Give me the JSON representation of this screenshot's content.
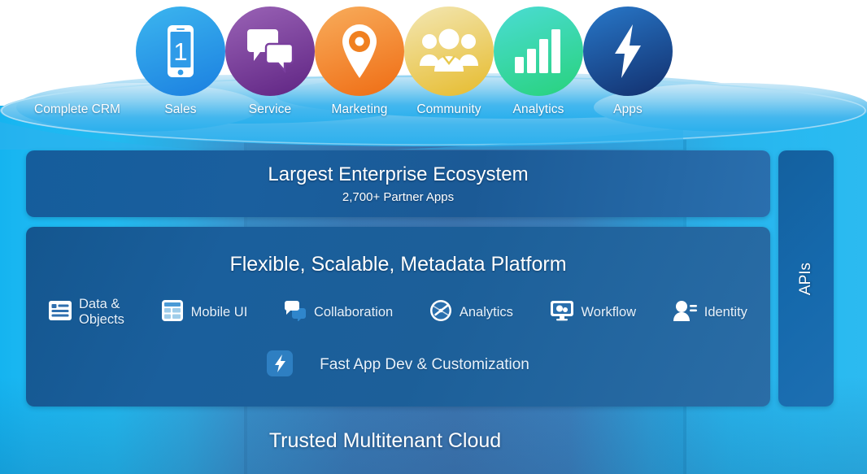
{
  "diagram": {
    "top_row": {
      "standalone_label": "Complete CRM",
      "nodes": [
        {
          "label": "Sales",
          "icon": "mobile-phone-icon",
          "color_from": "#3cb6ef",
          "color_to": "#1b7fe0"
        },
        {
          "label": "Service",
          "icon": "chat-bubbles-icon",
          "color_from": "#8f5fb0",
          "color_to": "#6a2a8c"
        },
        {
          "label": "Marketing",
          "icon": "map-pin-icon",
          "color_from": "#f5a04a",
          "color_to": "#f2711c"
        },
        {
          "label": "Community",
          "icon": "people-group-icon",
          "color_from": "#efe0a8",
          "color_to": "#e8bf33"
        },
        {
          "label": "Analytics",
          "icon": "bar-chart-icon",
          "color_from": "#45d8d0",
          "color_to": "#2ad47f"
        },
        {
          "label": "Apps",
          "icon": "lightning-bolt-icon",
          "color_from": "#1f6fc4",
          "color_to": "#12306f"
        }
      ]
    },
    "ecosystem_panel": {
      "title": "Largest Enterprise Ecosystem",
      "subtitle": "2,700+ Partner Apps"
    },
    "platform_panel": {
      "title": "Flexible, Scalable, Metadata Platform",
      "features_row1": [
        {
          "label": "Data &\nObjects",
          "icon": "data-objects-icon"
        },
        {
          "label": "Mobile UI",
          "icon": "mobile-ui-icon"
        },
        {
          "label": "Collaboration",
          "icon": "collaboration-icon"
        },
        {
          "label": "Analytics",
          "icon": "gauge-analytics-icon"
        },
        {
          "label": "Workflow",
          "icon": "workflow-monitor-icon"
        },
        {
          "label": "Identity",
          "icon": "identity-person-icon"
        }
      ],
      "features_row2": [
        {
          "label": "Fast App Dev & Customization",
          "icon": "lightning-bolt-square-icon"
        }
      ]
    },
    "apis_panel": {
      "label": "APIs"
    },
    "footer": {
      "label": "Trusted Multitenant Cloud"
    },
    "colors": {
      "cloud_light": "#15b4f0",
      "cloud_mid": "#3f79b4",
      "panel_blue": "#1a5f9e",
      "text_white": "#ffffff"
    }
  }
}
